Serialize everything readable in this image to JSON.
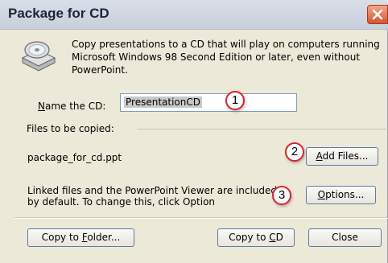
{
  "window": {
    "title": "Package for CD"
  },
  "intro": {
    "text": "Copy presentations to a CD that will play on computers running Microsoft Windows 98 Second Edition or later, even without PowerPoint."
  },
  "name_cd": {
    "label": "Name the CD:",
    "value": "PresentationCD"
  },
  "files": {
    "section_label": "Files to be copied:",
    "items": [
      "package_for_cd.ppt"
    ],
    "add_button": "Add Files...",
    "linked_text": "Linked files and the PowerPoint Viewer are included by default. To change this, click Option",
    "options_button": "Options..."
  },
  "footer": {
    "copy_folder_button": "Copy to Folder...",
    "copy_cd_button": "Copy to CD",
    "close_button": "Close"
  },
  "callouts": [
    "1",
    "2",
    "3"
  ],
  "colors": {
    "dialog_bg": "#ece9d8",
    "callout_border": "#d8242b",
    "close_button": "#d65532"
  },
  "icons": [
    "cd-drive-icon",
    "close-icon"
  ]
}
